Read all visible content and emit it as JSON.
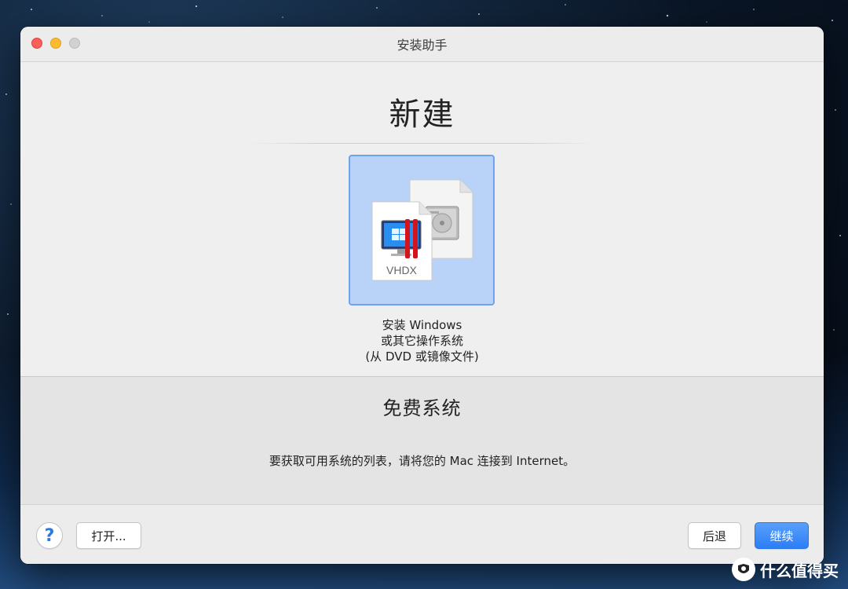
{
  "window": {
    "title": "安装助手"
  },
  "main": {
    "heading": "新建",
    "install_option": {
      "badge": "VHDX",
      "line1": "安装 Windows",
      "line2": "或其它操作系统",
      "line3": "(从 DVD 或镜像文件)"
    }
  },
  "free_systems": {
    "title": "免费系统",
    "message": "要获取可用系统的列表，请将您的 Mac 连接到 Internet。"
  },
  "footer": {
    "help_label": "?",
    "open_label": "打开...",
    "back_label": "后退",
    "continue_label": "继续"
  },
  "watermark": {
    "text": "什么值得买"
  },
  "colors": {
    "accent": "#2b7ef6",
    "selection": "#b9d2f7",
    "parallels_red": "#d4141c"
  }
}
